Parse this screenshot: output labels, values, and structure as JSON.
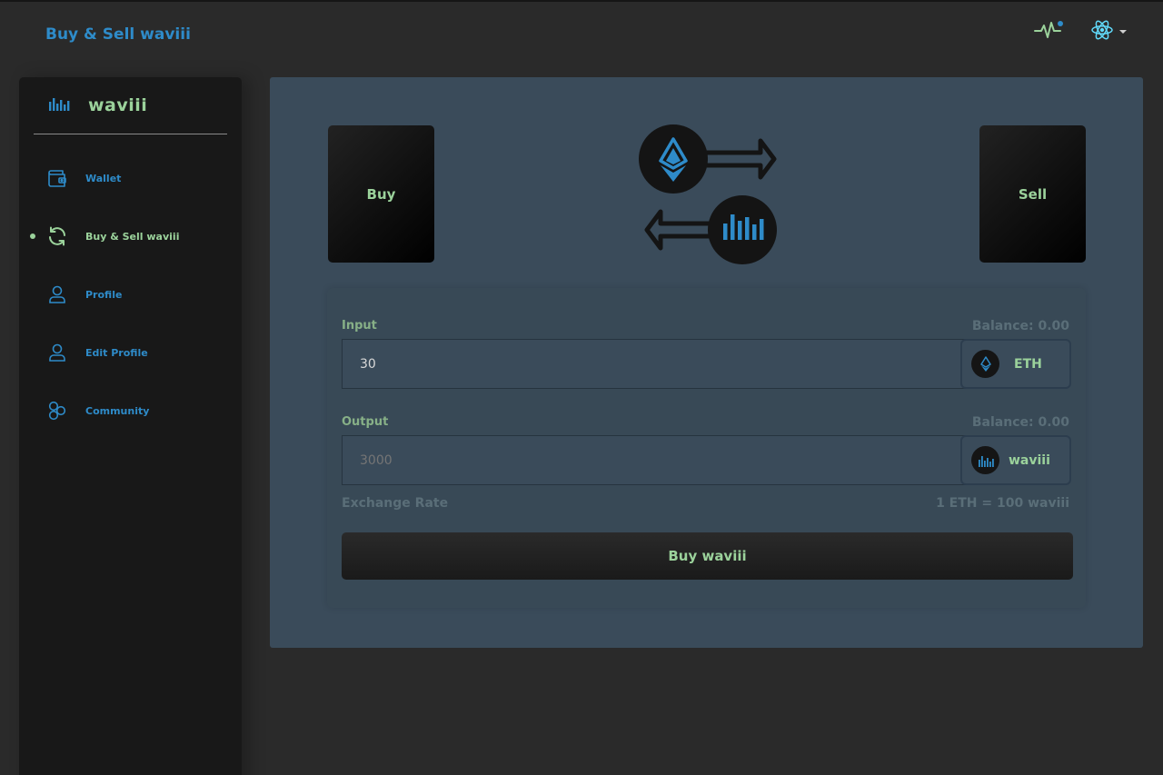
{
  "header": {
    "title": "Buy & Sell waviii",
    "activity_icon": "pulse-icon",
    "app_icon": "react-atom-icon",
    "accent_color": "#2e8bc9",
    "green_color": "#9bd29b"
  },
  "sidebar": {
    "brand": {
      "label": "waviii",
      "icon": "waviii-logo-icon"
    },
    "items": [
      {
        "label": "Wallet",
        "icon": "wallet-icon",
        "active": false
      },
      {
        "label": "Buy & Sell waviii",
        "icon": "refresh-icon",
        "active": true
      },
      {
        "label": "Profile",
        "icon": "user-icon",
        "active": false
      },
      {
        "label": "Edit Profile",
        "icon": "user-edit-icon",
        "active": false
      },
      {
        "label": "Community",
        "icon": "community-icon",
        "active": false
      }
    ]
  },
  "main": {
    "buy_card": "Buy",
    "sell_card": "Sell",
    "illustration_icons": [
      "ethereum-icon",
      "arrow-right-icon",
      "arrow-left-icon",
      "waviii-token-icon"
    ],
    "form": {
      "input": {
        "label": "Input",
        "balance": "Balance: 0.00",
        "value": "30",
        "token": "ETH",
        "token_icon": "ethereum-icon"
      },
      "output": {
        "label": "Output",
        "balance": "Balance: 0.00",
        "placeholder": "3000",
        "token": "waviii",
        "token_icon": "waviii-token-icon"
      },
      "rate_label": "Exchange Rate",
      "rate_value": "1 ETH = 100 waviii",
      "submit_label": "Buy waviii"
    }
  }
}
